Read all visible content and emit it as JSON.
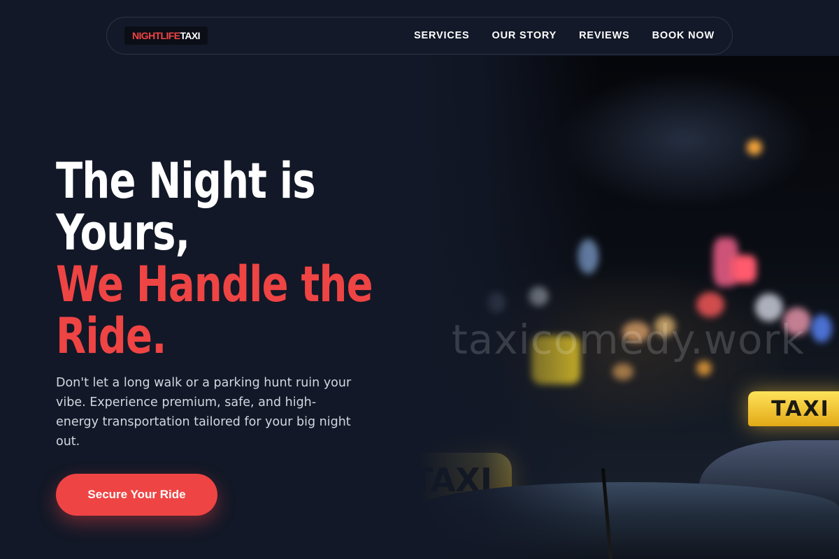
{
  "brand": {
    "logo_part1": "NIGHTLIFE",
    "logo_part2": "TAXI",
    "accent_color": "#ef4444",
    "background_color": "#121827"
  },
  "nav": {
    "items": [
      {
        "label": "SERVICES"
      },
      {
        "label": "OUR STORY"
      },
      {
        "label": "REVIEWS"
      },
      {
        "label": "BOOK NOW"
      }
    ]
  },
  "hero": {
    "headline_line1": "The Night is Yours,",
    "headline_line2": "We Handle the Ride.",
    "subtitle": "Don't let a long walk or a parking hunt ruin your vibe. Experience premium, safe, and high-energy transportation tailored for your big night out.",
    "cta_label": "Secure Your Ride"
  },
  "image": {
    "watermark": "taxicomedy.work",
    "sign_text": "TAXI"
  }
}
